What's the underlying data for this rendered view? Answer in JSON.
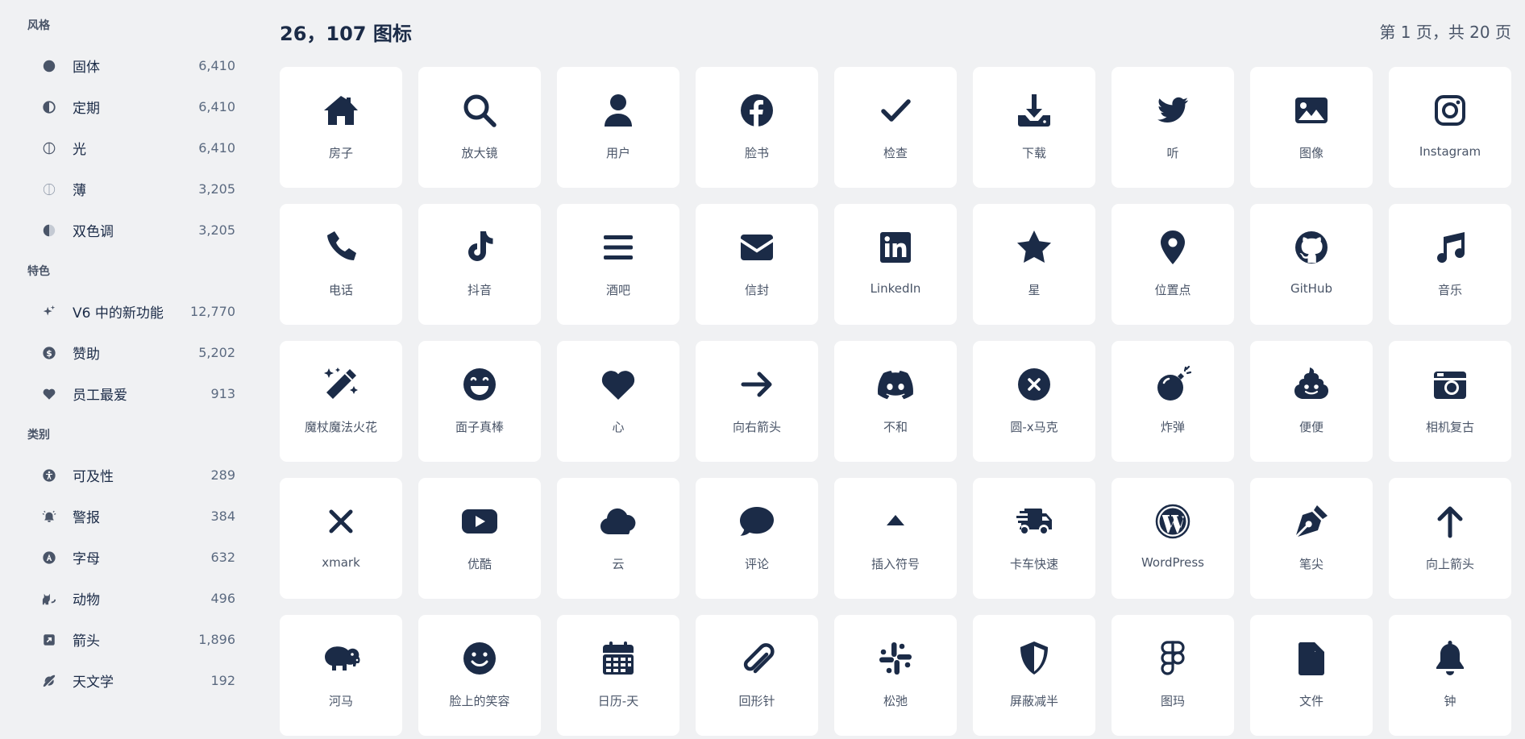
{
  "sidebar": {
    "styles": {
      "title": "风格",
      "items": [
        {
          "label": "固体",
          "count": "6,410",
          "icon": "circle-solid-icon"
        },
        {
          "label": "定期",
          "count": "6,410",
          "icon": "circle-half-icon"
        },
        {
          "label": "光",
          "count": "6,410",
          "icon": "circle-light-icon"
        },
        {
          "label": "薄",
          "count": "3,205",
          "icon": "circle-thin-icon"
        },
        {
          "label": "双色调",
          "count": "3,205",
          "icon": "circle-duotone-icon"
        }
      ]
    },
    "features": {
      "title": "特色",
      "items": [
        {
          "label": "V6 中的新功能",
          "count": "12,770",
          "icon": "sparkles-icon"
        },
        {
          "label": "赞助",
          "count": "5,202",
          "icon": "dollar-circle-icon"
        },
        {
          "label": "员工最爱",
          "count": "913",
          "icon": "heart-icon"
        }
      ]
    },
    "categories": {
      "title": "类别",
      "items": [
        {
          "label": "可及性",
          "count": "289",
          "icon": "accessibility-icon"
        },
        {
          "label": "警报",
          "count": "384",
          "icon": "alarm-bell-icon"
        },
        {
          "label": "字母",
          "count": "632",
          "icon": "letter-a-icon"
        },
        {
          "label": "动物",
          "count": "496",
          "icon": "cat-icon"
        },
        {
          "label": "箭头",
          "count": "1,896",
          "icon": "arrow-square-icon"
        },
        {
          "label": "天文学",
          "count": "192",
          "icon": "planet-icon"
        }
      ]
    }
  },
  "header": {
    "title": "26，107 图标",
    "pager": "第 1 页，共 20 页"
  },
  "icons": [
    {
      "label": "房子",
      "icon": "house"
    },
    {
      "label": "放大镜",
      "icon": "magnifier"
    },
    {
      "label": "用户",
      "icon": "user"
    },
    {
      "label": "脸书",
      "icon": "facebook"
    },
    {
      "label": "检查",
      "icon": "check"
    },
    {
      "label": "下载",
      "icon": "download"
    },
    {
      "label": "听",
      "icon": "twitter"
    },
    {
      "label": "图像",
      "icon": "image"
    },
    {
      "label": "Instagram",
      "icon": "instagram"
    },
    {
      "label": "电话",
      "icon": "phone"
    },
    {
      "label": "抖音",
      "icon": "tiktok"
    },
    {
      "label": "酒吧",
      "icon": "bars"
    },
    {
      "label": "信封",
      "icon": "envelope"
    },
    {
      "label": "LinkedIn",
      "icon": "linkedin"
    },
    {
      "label": "星",
      "icon": "star"
    },
    {
      "label": "位置点",
      "icon": "location-dot"
    },
    {
      "label": "GitHub",
      "icon": "github"
    },
    {
      "label": "音乐",
      "icon": "music"
    },
    {
      "label": "魔杖魔法火花",
      "icon": "wand-sparkles"
    },
    {
      "label": "面子真棒",
      "icon": "face-grin"
    },
    {
      "label": "心",
      "icon": "heart"
    },
    {
      "label": "向右箭头",
      "icon": "arrow-right"
    },
    {
      "label": "不和",
      "icon": "discord"
    },
    {
      "label": "圆-x马克",
      "icon": "circle-xmark"
    },
    {
      "label": "炸弹",
      "icon": "bomb"
    },
    {
      "label": "便便",
      "icon": "poo"
    },
    {
      "label": "相机复古",
      "icon": "camera-retro"
    },
    {
      "label": "xmark",
      "icon": "xmark"
    },
    {
      "label": "优酷",
      "icon": "youtube"
    },
    {
      "label": "云",
      "icon": "cloud"
    },
    {
      "label": "评论",
      "icon": "comment"
    },
    {
      "label": "插入符号",
      "icon": "caret-up"
    },
    {
      "label": "卡车快速",
      "icon": "truck-fast"
    },
    {
      "label": "WordPress",
      "icon": "wordpress"
    },
    {
      "label": "笔尖",
      "icon": "pen-nib"
    },
    {
      "label": "向上箭头",
      "icon": "arrow-up"
    },
    {
      "label": "河马",
      "icon": "hippo"
    },
    {
      "label": "脸上的笑容",
      "icon": "face-smile"
    },
    {
      "label": "日历-天",
      "icon": "calendar-days"
    },
    {
      "label": "回形针",
      "icon": "paperclip"
    },
    {
      "label": "松弛",
      "icon": "slack"
    },
    {
      "label": "屏蔽减半",
      "icon": "shield-halved"
    },
    {
      "label": "图玛",
      "icon": "figma"
    },
    {
      "label": "文件",
      "icon": "file"
    },
    {
      "label": "钟",
      "icon": "bell"
    }
  ]
}
